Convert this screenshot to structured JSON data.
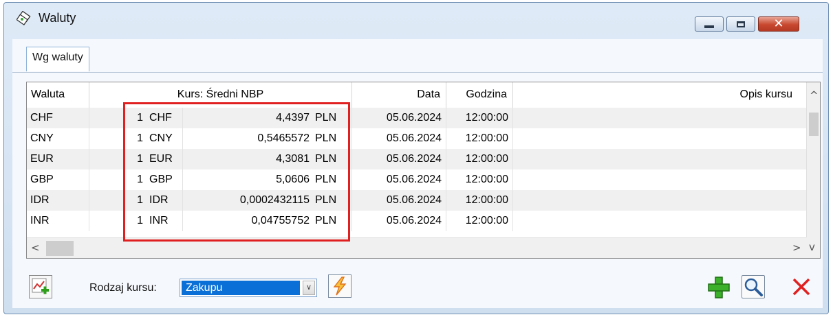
{
  "window": {
    "title": "Waluty",
    "app_icon": "currency-icon",
    "buttons": {
      "minimize": "minimize-icon",
      "maximize": "maximize-icon",
      "close": "close-icon",
      "close_glyph": "✕"
    }
  },
  "tabs": [
    {
      "label": "Wg waluty",
      "active": true
    }
  ],
  "grid": {
    "columns": [
      {
        "key": "waluta",
        "label": "Waluta"
      },
      {
        "key": "kurs",
        "label": "Kurs: Średni NBP"
      },
      {
        "key": "data",
        "label": "Data"
      },
      {
        "key": "godzina",
        "label": "Godzina"
      },
      {
        "key": "opis",
        "label": "Opis kursu"
      }
    ],
    "rows": [
      {
        "waluta": "CHF",
        "qty": "1",
        "code": "CHF",
        "rate": "4,4397",
        "base": "PLN",
        "data": "05.06.2024",
        "godzina": "12:00:00",
        "opis": ""
      },
      {
        "waluta": "CNY",
        "qty": "1",
        "code": "CNY",
        "rate": "0,5465572",
        "base": "PLN",
        "data": "05.06.2024",
        "godzina": "12:00:00",
        "opis": ""
      },
      {
        "waluta": "EUR",
        "qty": "1",
        "code": "EUR",
        "rate": "4,3081",
        "base": "PLN",
        "data": "05.06.2024",
        "godzina": "12:00:00",
        "opis": ""
      },
      {
        "waluta": "GBP",
        "qty": "1",
        "code": "GBP",
        "rate": "5,0606",
        "base": "PLN",
        "data": "05.06.2024",
        "godzina": "12:00:00",
        "opis": ""
      },
      {
        "waluta": "IDR",
        "qty": "1",
        "code": "IDR",
        "rate": "0,0002432115",
        "base": "PLN",
        "data": "05.06.2024",
        "godzina": "12:00:00",
        "opis": ""
      },
      {
        "waluta": "INR",
        "qty": "1",
        "code": "INR",
        "rate": "0,04755752",
        "base": "PLN",
        "data": "05.06.2024",
        "godzina": "12:00:00",
        "opis": ""
      }
    ],
    "scroll": {
      "up": "^",
      "down": "v",
      "left": "<",
      "right": ">"
    }
  },
  "footer": {
    "chart_button_icon": "chart-add-icon",
    "rate_kind_label": "Rodzaj kursu:",
    "rate_kind_value": "Zakupu",
    "combo_arrow": "∨",
    "flash_button_icon": "lightning-icon",
    "add_button_icon": "plus-icon",
    "search_button_icon": "magnifier-icon",
    "delete_button_icon": "delete-x-icon"
  },
  "colors": {
    "highlight": "#e02020",
    "selection": "#0a6fd6",
    "add_green": "#2f9e1a",
    "delete_red": "#e02020",
    "lightning": "#f0a020"
  }
}
